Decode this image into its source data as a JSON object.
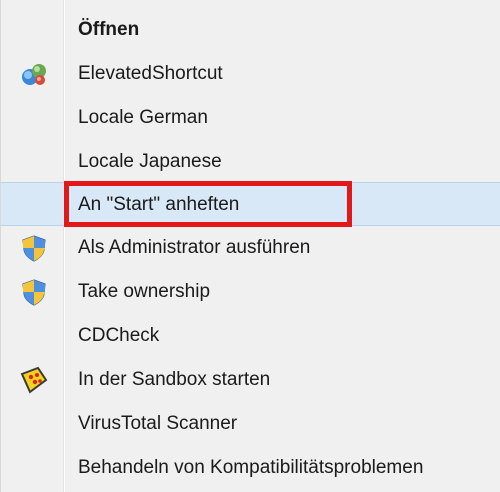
{
  "menu": {
    "items": [
      {
        "label": "Öffnen",
        "icon": ""
      },
      {
        "label": "ElevatedShortcut",
        "icon": "globe-app-icon"
      },
      {
        "label": "Locale German",
        "icon": ""
      },
      {
        "label": "Locale Japanese",
        "icon": ""
      },
      {
        "label": "An \"Start\" anheften",
        "icon": ""
      },
      {
        "label": "Als Administrator ausführen",
        "icon": "uac-shield-icon"
      },
      {
        "label": "Take ownership",
        "icon": "uac-shield-icon"
      },
      {
        "label": "CDCheck",
        "icon": ""
      },
      {
        "label": "In der Sandbox starten",
        "icon": "sandbox-icon"
      },
      {
        "label": "VirusTotal Scanner",
        "icon": ""
      },
      {
        "label": "Behandeln von Kompatibilitätsproblemen",
        "icon": ""
      }
    ],
    "hovered_index": 4,
    "highlight_color": "#e31818",
    "hover_color": "#d9e8f7"
  }
}
